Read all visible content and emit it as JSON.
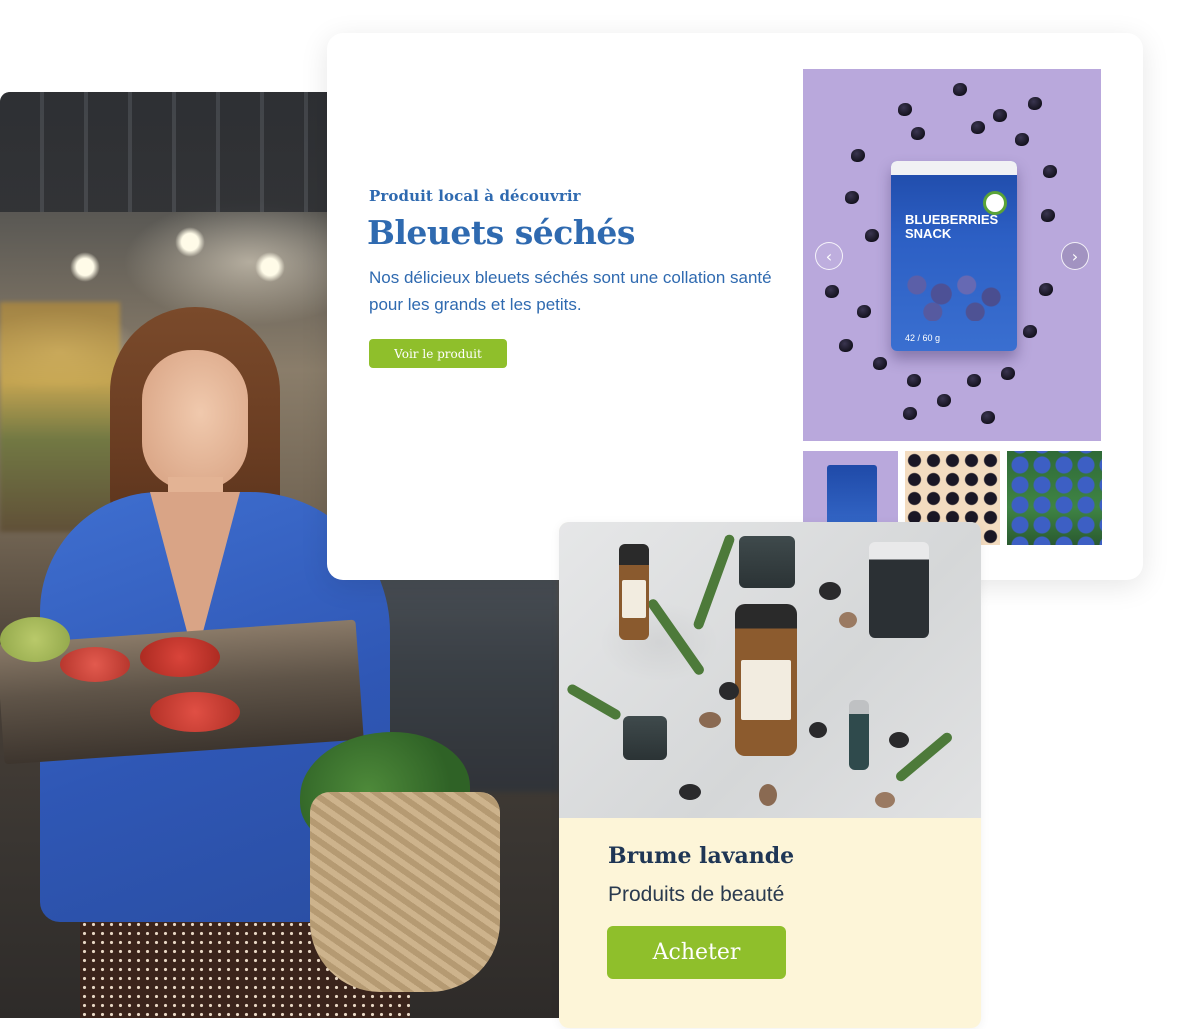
{
  "feature": {
    "eyebrow": "Produit local à découvrir",
    "title": "Bleuets séchés",
    "description": "Nos délicieux bleuets séchés sont une collation santé pour les grands et les petits.",
    "cta_label": "Voir le produit",
    "gallery": {
      "package_text": "BLUEBERRIES SNACK",
      "package_weight": "42 / 60 g",
      "prev_icon": "chevron-left-icon",
      "next_icon": "chevron-right-icon",
      "thumbnails": [
        "blueberry-snack-pouch",
        "dried-blueberries-pattern",
        "fresh-blueberries-field"
      ]
    }
  },
  "beauty": {
    "title": "Brume lavande",
    "category": "Produits de beauté",
    "cta_label": "Acheter"
  },
  "colors": {
    "accent_blue": "#2f6ab0",
    "cta_green": "#8fbf2b",
    "beauty_card_bg": "#fdf5d8",
    "beauty_title": "#1f3655",
    "gallery_lavender": "#b9a8dc"
  }
}
